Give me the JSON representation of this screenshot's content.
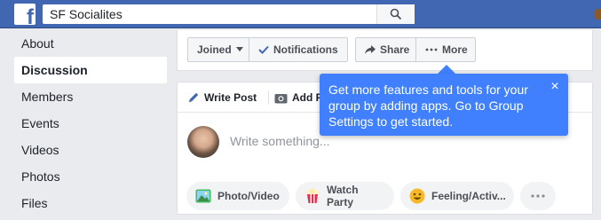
{
  "header": {
    "search_value": "SF Socialites"
  },
  "sidebar": {
    "items": [
      {
        "label": "About"
      },
      {
        "label": "Discussion"
      },
      {
        "label": "Members"
      },
      {
        "label": "Events"
      },
      {
        "label": "Videos"
      },
      {
        "label": "Photos"
      },
      {
        "label": "Files"
      }
    ]
  },
  "action_bar": {
    "joined_label": "Joined",
    "notifications_label": "Notifications",
    "share_label": "Share",
    "more_label": "More"
  },
  "composer": {
    "tab_write": "Write Post",
    "tab_add": "Add P",
    "placeholder": "Write something...",
    "actions": {
      "photo": "Photo/Video",
      "watch": "Watch Party",
      "feeling": "Feeling/Activ..."
    }
  },
  "tooltip": {
    "text": "Get more features and tools for your group by adding apps. Go to Group Settings to get started.",
    "close_glyph": "×"
  },
  "colors": {
    "brand_blue": "#4267b2",
    "tooltip_blue": "#4080ff",
    "page_bg": "#e9ebee"
  }
}
